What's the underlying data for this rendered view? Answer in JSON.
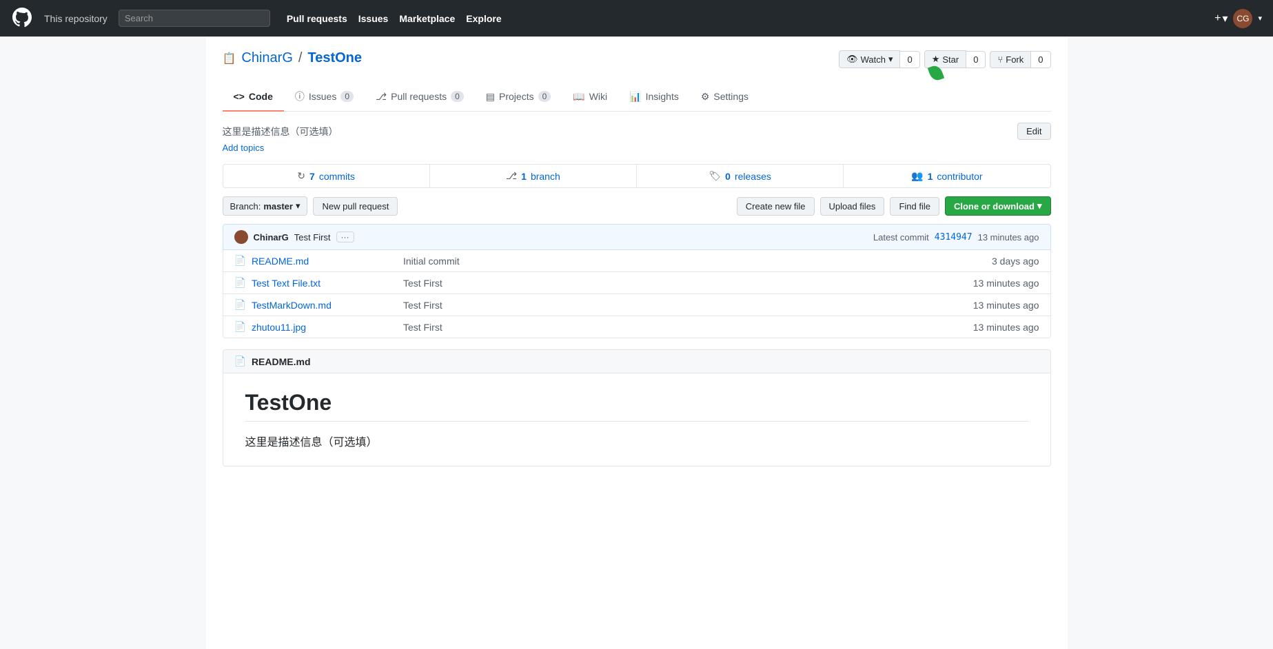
{
  "topnav": {
    "repo_label": "This repository",
    "search_placeholder": "Search",
    "links": [
      {
        "id": "pull-requests",
        "label": "Pull requests"
      },
      {
        "id": "issues",
        "label": "Issues"
      },
      {
        "id": "marketplace",
        "label": "Marketplace"
      },
      {
        "id": "explore",
        "label": "Explore"
      }
    ],
    "plus_label": "+",
    "dropdown_caret": "▾"
  },
  "repo": {
    "owner": "ChinarG",
    "name": "TestOne",
    "description": "这里是描述信息（可选填）",
    "add_topics_label": "Add topics"
  },
  "actions": {
    "watch_label": "Watch",
    "watch_count": "0",
    "star_label": "Star",
    "star_count": "0",
    "fork_label": "Fork",
    "fork_count": "0",
    "edit_label": "Edit"
  },
  "tabs": [
    {
      "id": "code",
      "label": "Code",
      "icon": "<>",
      "badge": null,
      "active": true
    },
    {
      "id": "issues",
      "label": "Issues",
      "icon": "ⓘ",
      "badge": "0",
      "active": false
    },
    {
      "id": "pull-requests",
      "label": "Pull requests",
      "icon": "⎇",
      "badge": "0",
      "active": false
    },
    {
      "id": "projects",
      "label": "Projects",
      "icon": "▤",
      "badge": "0",
      "active": false
    },
    {
      "id": "wiki",
      "label": "Wiki",
      "icon": "📖",
      "badge": null,
      "active": false
    },
    {
      "id": "insights",
      "label": "Insights",
      "icon": "📊",
      "badge": null,
      "active": false
    },
    {
      "id": "settings",
      "label": "Settings",
      "icon": "⚙",
      "badge": null,
      "active": false
    }
  ],
  "stats": [
    {
      "id": "commits",
      "icon": "↻",
      "value": "7",
      "label": "commits"
    },
    {
      "id": "branches",
      "icon": "⎇",
      "value": "1",
      "label": "branch"
    },
    {
      "id": "releases",
      "icon": "🏷",
      "value": "0",
      "label": "releases"
    },
    {
      "id": "contributors",
      "icon": "👥",
      "value": "1",
      "label": "contributor"
    }
  ],
  "file_controls": {
    "branch_label": "Branch:",
    "branch_name": "master",
    "branch_caret": "▾",
    "new_pr_label": "New pull request",
    "create_file_label": "Create new file",
    "upload_files_label": "Upload files",
    "find_file_label": "Find file",
    "clone_label": "Clone or download",
    "clone_caret": "▾"
  },
  "latest_commit": {
    "author": "ChinarG",
    "message": "Test First",
    "ellipsis": "···",
    "sha_label": "Latest commit",
    "sha": "4314947",
    "time": "13 minutes ago"
  },
  "files": [
    {
      "id": "readme-md",
      "icon": "📄",
      "name": "README.md",
      "message": "Initial commit",
      "time": "3 days ago"
    },
    {
      "id": "test-text",
      "icon": "📄",
      "name": "Test Text File.txt",
      "message": "Test First",
      "time": "13 minutes ago"
    },
    {
      "id": "testmarkdown",
      "icon": "📄",
      "name": "TestMarkDown.md",
      "message": "Test First",
      "time": "13 minutes ago"
    },
    {
      "id": "zhutou11",
      "icon": "📄",
      "name": "zhutou11.jpg",
      "message": "Test First",
      "time": "13 minutes ago"
    }
  ],
  "readme": {
    "header_icon": "📄",
    "header_label": "README.md",
    "title": "TestOne",
    "description": "这里是描述信息（可选填）"
  }
}
